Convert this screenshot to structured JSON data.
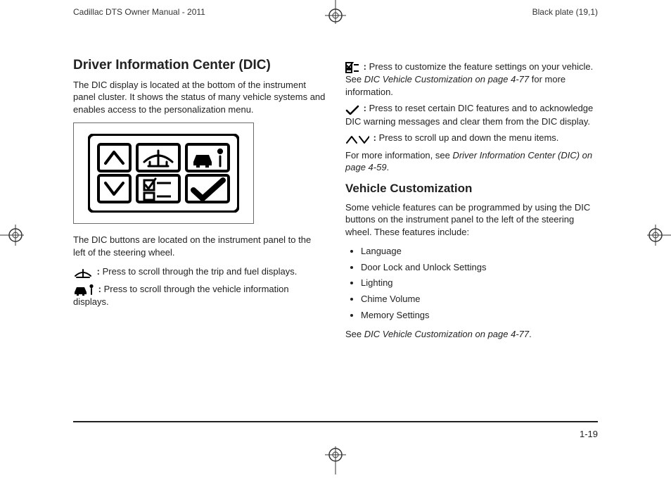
{
  "header": {
    "left": "Cadillac DTS Owner Manual - 2011",
    "right": "Black plate (19,1)"
  },
  "left_col": {
    "title": "Driver Information Center (DIC)",
    "intro": "The DIC display is located at the bottom of the instrument panel cluster. It shows the status of many vehicle systems and enables access to the personalization menu.",
    "caption": "The DIC buttons are located on the instrument panel to the left of the steering wheel.",
    "entry_trip": "Press to scroll through the trip and fuel displays.",
    "entry_info": "Press to scroll through the vehicle information displays."
  },
  "right_col": {
    "entry_custom_a": "Press to customize the feature settings on your vehicle. See ",
    "entry_custom_ref": "DIC Vehicle Customization on page 4-77",
    "entry_custom_b": " for more information.",
    "entry_check": "Press to reset certain DIC features and to acknowledge DIC warning messages and clear them from the DIC display.",
    "entry_updown": "Press to scroll up and down the menu items.",
    "more_info_a": "For more information, see ",
    "more_info_ref": "Driver Information Center (DIC) on page 4-59",
    "more_info_b": ".",
    "sub_title": "Vehicle Customization",
    "sub_intro": "Some vehicle features can be programmed by using the DIC buttons on the instrument panel to the left of the steering wheel. These features include:",
    "features": [
      "Language",
      "Door Lock and Unlock Settings",
      "Lighting",
      "Chime Volume",
      "Memory Settings"
    ],
    "see_a": "See ",
    "see_ref": "DIC Vehicle Customization on page 4-77",
    "see_b": "."
  },
  "footer": {
    "page_num": "1-19"
  }
}
